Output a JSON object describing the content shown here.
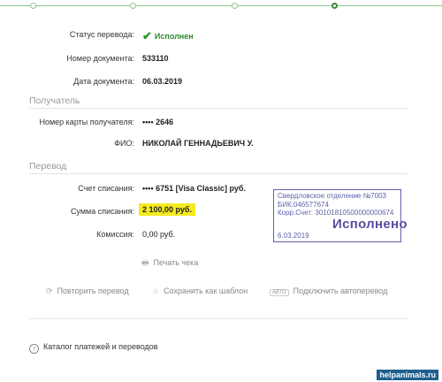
{
  "fields": {
    "status": {
      "label": "Статус перевода:",
      "value": "Исполнен"
    },
    "doc_number": {
      "label": "Номер документа:",
      "value": "533110"
    },
    "doc_date": {
      "label": "Дата документа:",
      "value": "06.03.2019"
    }
  },
  "recipient_section": {
    "title": "Получатель",
    "card": {
      "label": "Номер карты получателя:",
      "value": "•••• 2646"
    },
    "name": {
      "label": "ФИО:",
      "value": "НИКОЛАЙ ГЕННАДЬЕВИЧ У."
    }
  },
  "transfer_section": {
    "title": "Перевод",
    "account": {
      "label": "Счет списания:",
      "value": "•••• 6751  [Visa Classic]  руб."
    },
    "amount": {
      "label": "Сумма списания:",
      "value": "2 100,00  руб."
    },
    "commission": {
      "label": "Комиссия:",
      "value": "0,00 руб."
    }
  },
  "print_check": "Печать чека",
  "actions": {
    "repeat": "Повторить перевод",
    "save_template": "Сохранить как шаблон",
    "auto_badge": "АВТО",
    "autopay": "Подключить автоперевод"
  },
  "stamp": {
    "line1": "Свердловское отделение №7003",
    "line2": "БИК:046577674",
    "line3": "Корр.Счет: 30101810500000000674",
    "status": "Исполнено",
    "date": "6.03.2019"
  },
  "catalog_link": "Каталог платежей и переводов",
  "watermark": "helpanimals.ru",
  "colors": {
    "accent_green": "#2e8b2e",
    "highlight_yellow": "#f4ea1f",
    "stamp_blue": "#5d62a8"
  }
}
